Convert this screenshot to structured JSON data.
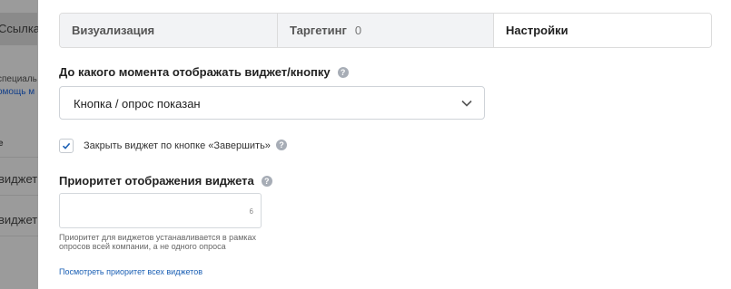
{
  "background": {
    "chip_text": "Ссылка",
    "line1": "специаль",
    "line2": "омощь м",
    "col_header": "е",
    "row1": "виджет",
    "row2": "виджет"
  },
  "tabs": [
    {
      "label": "Визуализация",
      "count": ""
    },
    {
      "label": "Таргетинг",
      "count": "0"
    },
    {
      "label": "Настройки",
      "count": ""
    }
  ],
  "display_until": {
    "label": "До какого момента отображать виджет/кнопку",
    "selected": "Кнопка / опрос показан"
  },
  "close_checkbox": {
    "label": "Закрыть виджет по кнопке «Завершить»",
    "checked": true
  },
  "priority": {
    "label": "Приоритет отображения виджета",
    "value": "6",
    "hint": "Приоритет для виджетов устанавливается в рамках опросов всей компании, а не одного опроса",
    "link": "Посмотреть приоритет всех виджетов"
  },
  "colors": {
    "accent": "#1a5fb4",
    "overlay": "#9b9b9b",
    "tab_inactive_bg": "#f2f3f5"
  }
}
